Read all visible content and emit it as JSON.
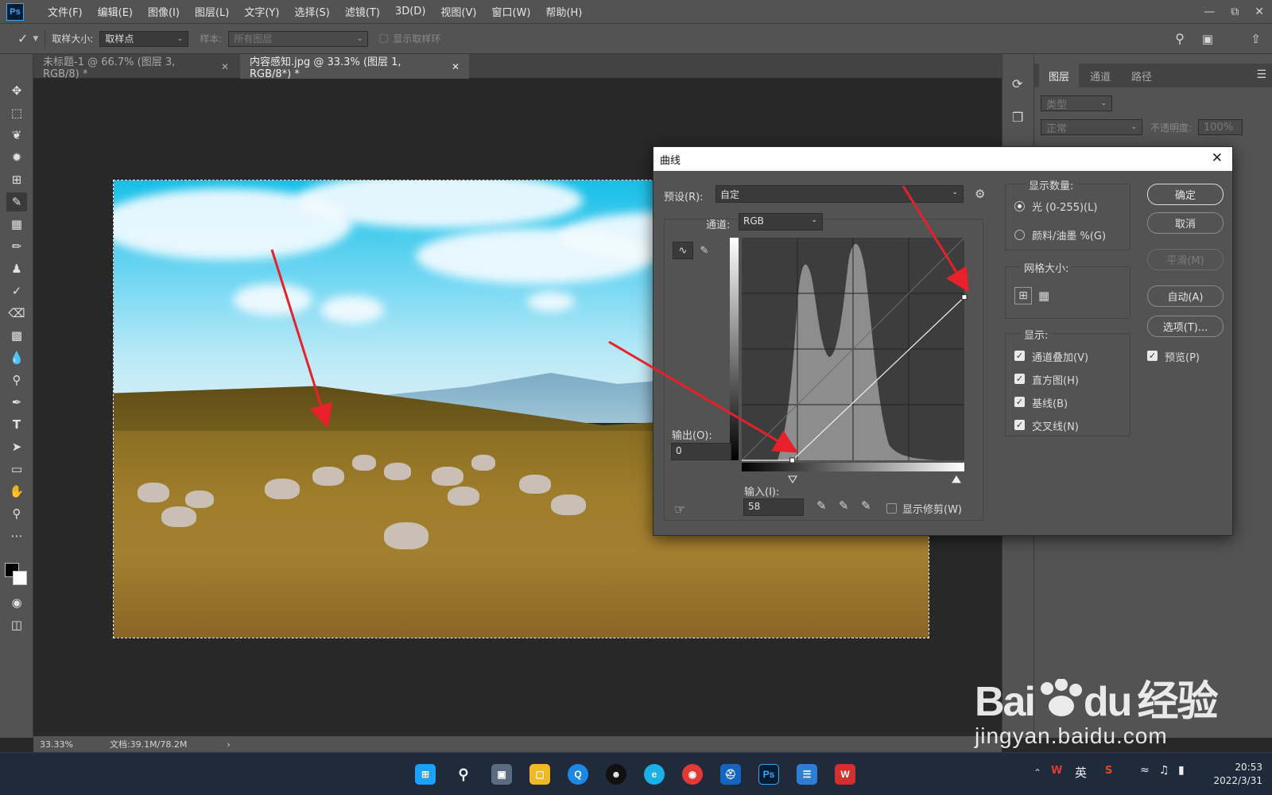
{
  "app": {
    "logo": "Ps",
    "menu": [
      "文件(F)",
      "编辑(E)",
      "图像(I)",
      "图层(L)",
      "文字(Y)",
      "选择(S)",
      "滤镜(T)",
      "3D(D)",
      "视图(V)",
      "窗口(W)",
      "帮助(H)"
    ]
  },
  "options_bar": {
    "sample_size_label": "取样大小:",
    "sample_size_value": "取样点",
    "sample_label": "样本:",
    "sample_value": "所有图层",
    "show_ring_label": "显示取样环"
  },
  "tabs": [
    {
      "label": "未标题-1 @ 66.7% (图层 3, RGB/8) *"
    },
    {
      "label": "内容感知.jpg @ 33.3% (图层 1, RGB/8*) *"
    }
  ],
  "status": {
    "zoom": "33.33%",
    "doc": "文档:39.1M/78.2M"
  },
  "layers_panel": {
    "tabs": [
      "图层",
      "通道",
      "路径"
    ],
    "filter_placeholder": "类型",
    "blend_mode": "正常",
    "opacity_label": "不透明度:",
    "opacity_value": "100%"
  },
  "curves": {
    "title": "曲线",
    "preset_label": "预设(R):",
    "preset_value": "自定",
    "channel_label": "通道:",
    "channel_value": "RGB",
    "output_label": "输出(O):",
    "output_value": "0",
    "input_label": "输入(I):",
    "input_value": "58",
    "show_clipping_label": "显示修剪(W)",
    "show_amount_label": "显示数量:",
    "light_label": "光 (0-255)(L)",
    "pigment_label": "颜料/油墨 %(G)",
    "grid_size_label": "网格大小:",
    "display_label": "显示:",
    "options": [
      "通道叠加(V)",
      "直方图(H)",
      "基线(B)",
      "交叉线(N)"
    ],
    "buttons": {
      "ok": "确定",
      "cancel": "取消",
      "smooth": "平滑(M)",
      "auto": "自动(A)",
      "options": "选项(T)..."
    },
    "preview_label": "预览(P)",
    "curve_points": [
      [
        0,
        0
      ],
      [
        58,
        0
      ],
      [
        255,
        187
      ]
    ]
  },
  "taskbar": {
    "ime": "英",
    "time": "20:53",
    "date": "2022/3/31"
  },
  "watermark": {
    "brand": "Bai",
    "brand_du": "du",
    "brand_cn": "经验",
    "url": "jingyan.baidu.com"
  },
  "colors": {
    "accent": "#31a8ff",
    "arrow": "#e8202a",
    "panel": "#535353"
  }
}
